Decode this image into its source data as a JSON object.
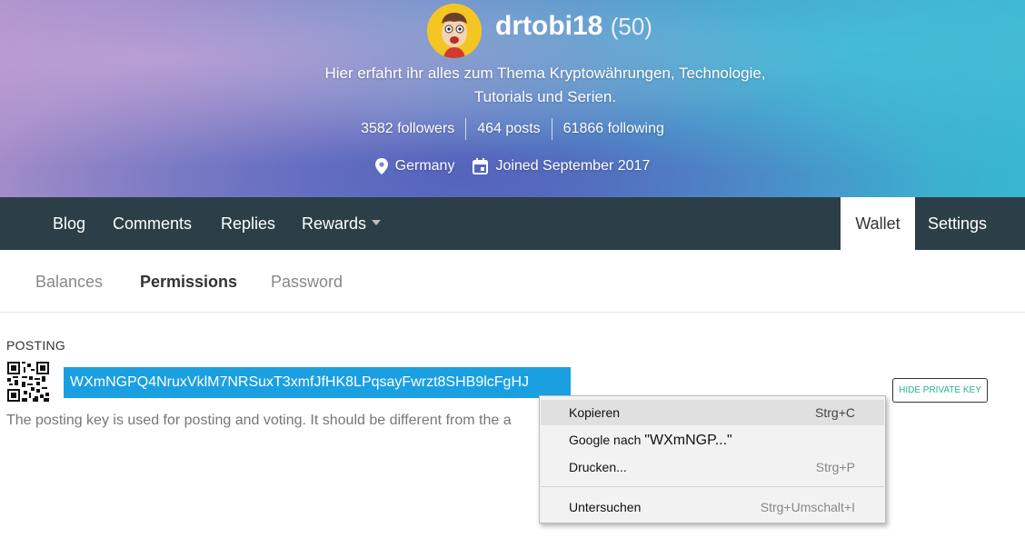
{
  "profile": {
    "username": "drtobi18",
    "reputation": "(50)",
    "about": "Hier erfahrt ihr alles zum Thema Kryptowährungen, Technologie, Tutorials und Serien.",
    "followers": "3582 followers",
    "posts": "464 posts",
    "following": "61866 following",
    "location": "Germany",
    "joined": "Joined September 2017"
  },
  "nav": {
    "blog": "Blog",
    "comments": "Comments",
    "replies": "Replies",
    "rewards": "Rewards",
    "wallet": "Wallet",
    "settings": "Settings"
  },
  "subtabs": {
    "balances": "Balances",
    "permissions": "Permissions",
    "password": "Password"
  },
  "posting": {
    "label": "POSTING",
    "key": "WXmNGPQ4NruxVklM7NRSuxT3xmfJfHK8LPqsayFwrzt8SHB9lcFgHJ",
    "hide_button": "HIDE PRIVATE KEY",
    "description": "The posting key is used for posting and voting. It should be different from the a"
  },
  "context_menu": {
    "copy": "Kopieren",
    "copy_shortcut": "Strg+C",
    "google_prefix": "Google nach ",
    "google_query": "\"WXmNGP...\"",
    "print": "Drucken...",
    "print_shortcut": "Strg+P",
    "inspect": "Untersuchen",
    "inspect_shortcut": "Strg+Umschalt+I"
  },
  "colors": {
    "nav_bg": "#2c3e48",
    "selection": "#1aa0e0",
    "accent": "#28b091"
  }
}
